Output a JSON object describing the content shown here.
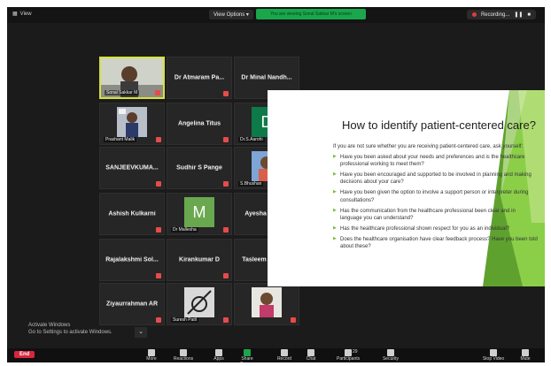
{
  "topbar": {
    "view_label": "View",
    "view_options_label": "View Options",
    "banner_text": "You are viewing Sonal Sakkar M's screen",
    "recording_label": "Recording..."
  },
  "participants": [
    {
      "name": "Dr Minal Nandh...",
      "sub": ""
    },
    {
      "name": "Dr Atmaram Pa...",
      "sub": ""
    },
    {
      "name": "",
      "sub": "Sonal Sakkar M",
      "photo": "person-video"
    },
    {
      "name": "D",
      "sub": "Dr.S.Aarohi",
      "avatar_letter": "D",
      "avatar_color": "#0e7a4a"
    },
    {
      "name": "Angelina Titus",
      "sub": ""
    },
    {
      "name": "",
      "sub": "Prashant Malik",
      "photo": "person-photo"
    },
    {
      "name": "",
      "sub": "S.Bhushan",
      "photo": "person-photo-2"
    },
    {
      "name": "Sudhir S Pange",
      "sub": ""
    },
    {
      "name": "SANJEEVKUMA...",
      "sub": ""
    },
    {
      "name": "Ayesha Shaikh",
      "sub": ""
    },
    {
      "name": "M",
      "sub": "Dr Mallesha",
      "avatar_letter": "M",
      "avatar_color": "#6aa84f"
    },
    {
      "name": "Ashish Kulkarni",
      "sub": ""
    },
    {
      "name": "Tasleem Kureshi",
      "sub": ""
    },
    {
      "name": "Kirankumar D",
      "sub": ""
    },
    {
      "name": "Rajalakshmi Sol...",
      "sub": ""
    },
    {
      "name": "",
      "sub": "",
      "photo": "woman-photo"
    },
    {
      "name": "",
      "sub": "Suresh Patil",
      "photo": "video-off"
    },
    {
      "name": "Ziyaurrahman AR",
      "sub": ""
    }
  ],
  "slide": {
    "title": "How to identify patient-centered care?",
    "intro": "If you are not sure whether you are receiving patient-centered care, ask yourself:",
    "bullets": [
      "Have you been asked about your needs and preferences and is the healthcare professional working to meet them?",
      "Have you been encouraged and supported to be involved in planning and making decisions about your care?",
      "Have you been given the option to involve a support person or interpreter during consultations?",
      "Has the communication from the healthcare professional been clear and in language you can understand?",
      "Has the healthcare professional shown respect for you as an individual?",
      "Does the healthcare organisation have clear feedback process? Have you been told about these?"
    ],
    "accent_color": "#7dbf3a"
  },
  "watermark": {
    "line1": "Activate Windows",
    "line2": "Go to Settings to activate Windows."
  },
  "toolbar": {
    "end": "End",
    "items": [
      "More",
      "Reactions",
      "Apps",
      "Share Screen",
      "Record",
      "Chat",
      "Participants",
      "Security",
      "Stop Video",
      "Mute"
    ],
    "participants_count": "29"
  }
}
